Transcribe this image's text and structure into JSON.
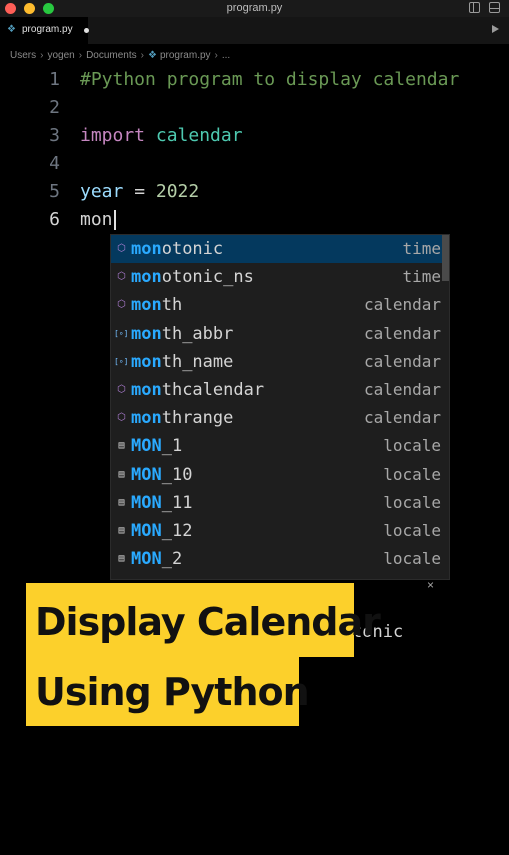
{
  "window": {
    "title": "program.py"
  },
  "tab": {
    "label": "program.py",
    "icon": "python-file-icon"
  },
  "breadcrumb": [
    "Users",
    "yogen",
    "Documents",
    "program.py",
    "..."
  ],
  "editor": {
    "lines": [
      {
        "n": "1",
        "comment": "#Python program to display calendar"
      },
      {
        "n": "2"
      },
      {
        "n": "3",
        "kw": "import",
        "mod": "calendar"
      },
      {
        "n": "4"
      },
      {
        "n": "5",
        "var": "year",
        "op": " = ",
        "num": "2022"
      },
      {
        "n": "6",
        "plain": "mon"
      }
    ]
  },
  "suggestions": [
    {
      "match": "mon",
      "rest": "otonic",
      "detail": "time",
      "icon": "method-icon"
    },
    {
      "match": "mon",
      "rest": "otonic_ns",
      "detail": "time",
      "icon": "method-icon"
    },
    {
      "match": "mon",
      "rest": "th",
      "detail": "calendar",
      "icon": "method-icon"
    },
    {
      "match": "mon",
      "rest": "th_abbr",
      "detail": "calendar",
      "icon": "variable-icon"
    },
    {
      "match": "mon",
      "rest": "th_name",
      "detail": "calendar",
      "icon": "variable-icon"
    },
    {
      "match": "mon",
      "rest": "thcalendar",
      "detail": "calendar",
      "icon": "method-icon"
    },
    {
      "match": "mon",
      "rest": "thrange",
      "detail": "calendar",
      "icon": "method-icon"
    },
    {
      "match": "MON",
      "rest": "_1",
      "detail": "locale",
      "icon": "constant-icon"
    },
    {
      "match": "MON",
      "rest": "_10",
      "detail": "locale",
      "icon": "constant-icon"
    },
    {
      "match": "MON",
      "rest": "_11",
      "detail": "locale",
      "icon": "constant-icon"
    },
    {
      "match": "MON",
      "rest": "_12",
      "detail": "locale",
      "icon": "constant-icon"
    },
    {
      "match": "MON",
      "rest": "_2",
      "detail": "locale",
      "icon": "constant-icon"
    }
  ],
  "details": {
    "close": "×",
    "text": "tonic"
  },
  "banner": {
    "line1": "Display Calendar",
    "line2": "Using Python"
  }
}
